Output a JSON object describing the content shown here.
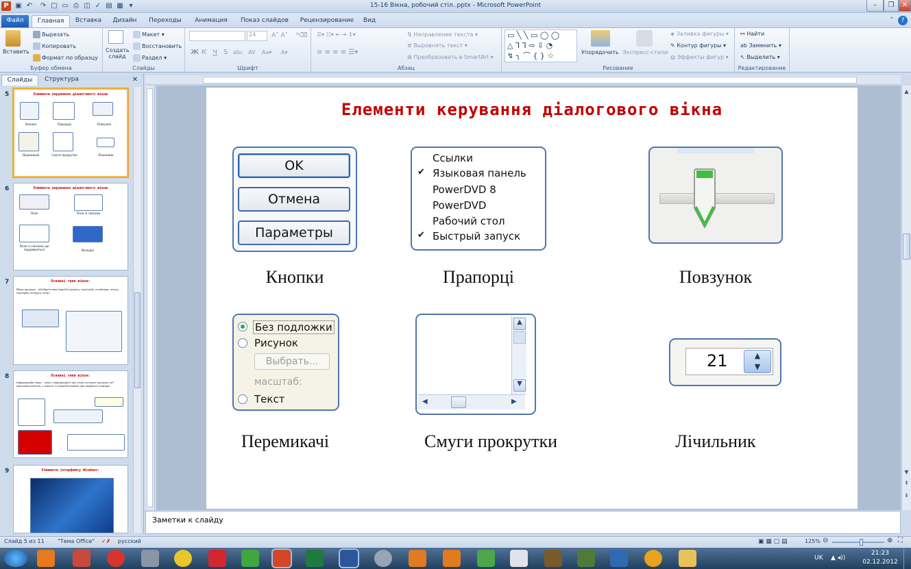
{
  "window": {
    "title": "15-16 Вікна, робочий стіл..pptx - Microsoft PowerPoint",
    "app_icon": "powerpoint-icon",
    "controls": [
      "minimize-icon",
      "maximize-icon",
      "close-icon"
    ]
  },
  "tabs": [
    {
      "label": "Файл"
    },
    {
      "label": "Главная"
    },
    {
      "label": "Вставка"
    },
    {
      "label": "Дизайн"
    },
    {
      "label": "Переходы"
    },
    {
      "label": "Анимация"
    },
    {
      "label": "Показ слайдов"
    },
    {
      "label": "Рецензирование"
    },
    {
      "label": "Вид"
    }
  ],
  "ribbon": {
    "clipboard": {
      "label": "Буфер обмена",
      "paste": "Вставить",
      "cut": "Вырезать",
      "copy": "Копировать",
      "format_painter": "Формат по образцу"
    },
    "slides": {
      "label": "Слайды",
      "new_slide": "Создать слайд",
      "layout": "Макет",
      "reset": "Восстановить",
      "section": "Раздел"
    },
    "font": {
      "label": "Шрифт",
      "font_size": "24"
    },
    "paragraph": {
      "label": "Абзац",
      "text_direction": "Направление текста",
      "align_text": "Выровнять текст",
      "convert_smartart": "Преобразовать в SmartArt"
    },
    "drawing": {
      "label": "Рисование",
      "arrange": "Упорядочить",
      "quick_styles": "Экспресс-стили",
      "shape_fill": "Заливка фигуры",
      "shape_outline": "Контур фигуры",
      "shape_effects": "Эффекты фигур"
    },
    "editing": {
      "label": "Редактирование",
      "find": "Найти",
      "replace": "Заменить",
      "select": "Выделить"
    }
  },
  "left_panel": {
    "tabs": [
      "Слайды",
      "Структура"
    ],
    "thumbnails": [
      {
        "num": "5",
        "title": "Елементи керування діалогового вікна",
        "labels": [
          "Кнопки",
          "Прапорці",
          "Повзунок",
          "Перемикачі",
          "Смуги прокрутки",
          "Лічильник"
        ]
      },
      {
        "num": "6",
        "title": "Елементи керування діалогового вікна",
        "labels": [
          "Поле",
          "Поле зі списком",
          "Поле зі списком, що відкривається",
          "Вкладки"
        ]
      },
      {
        "num": "7",
        "title": "Основні типи вікон:",
        "body": "Вікна програм – відображення (виробл) процесу, перегляду, складання, запису, перевірки на вірусу тощо"
      },
      {
        "num": "8",
        "title": "Основні типи вікон:",
        "body": "Інформаційні вікна – вікна з інформацією про стан системи, програм, хід виконання роботи, а також з попередженнями при аварійної ситуації."
      },
      {
        "num": "9",
        "title": "Елементи інтерфейсу Windows:"
      }
    ]
  },
  "slide": {
    "title": "Елементи керування діалогового вікна",
    "items": {
      "buttons": {
        "caption": "Кнопки",
        "labels": [
          "OK",
          "Отмена",
          "Параметры"
        ]
      },
      "checkboxes": {
        "caption": "Прапорці",
        "items": [
          {
            "text": "Ссылки",
            "checked": false
          },
          {
            "text": "Языковая панель",
            "checked": true
          },
          {
            "text": "PowerDVD 8",
            "checked": false
          },
          {
            "text": "PowerDVD",
            "checked": false
          },
          {
            "text": "Рабочий стол",
            "checked": false
          },
          {
            "text": "Быстрый запуск",
            "checked": true
          }
        ]
      },
      "slider": {
        "caption": "Повзунок"
      },
      "radios": {
        "caption": "Перемикачі",
        "items": [
          "Без подложки",
          "Рисунок",
          "Текст"
        ],
        "browse": "Выбрать...",
        "scale": "масштаб:"
      },
      "scrollbars": {
        "caption": "Смуги прокрутки"
      },
      "spinner": {
        "caption": "Лічильник",
        "value": "21"
      }
    }
  },
  "notes": {
    "placeholder": "Заметки к слайду"
  },
  "status": {
    "slide": "Слайд 5 из 11",
    "theme": "\"Тема Office\"",
    "language": "русский",
    "zoom": "125%"
  },
  "taskbar": {
    "lang": "UK",
    "time": "21:23",
    "date": "02.12.2012"
  }
}
